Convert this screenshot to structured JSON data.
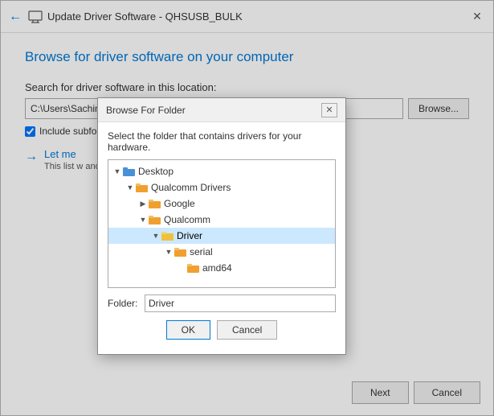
{
  "window": {
    "title": "Update Driver Software - QHSUSB_BULK",
    "close_label": "✕"
  },
  "page": {
    "title": "Browse for driver software on your computer",
    "section_label": "Search for driver software in this location:",
    "path_value": "C:\\Users\\Sachin\\Desktop\\Qualcomm Drivers\\Qualcomm\\Driver",
    "browse_button_label": "Browse...",
    "checkbox_label": "Include subfolders",
    "let_me_label": "Let me",
    "let_me_desc": "This list w                         and all driver software."
  },
  "buttons": {
    "next_label": "Next",
    "cancel_label": "Cancel"
  },
  "dialog": {
    "title": "Browse For Folder",
    "close_label": "✕",
    "description": "Select the folder that contains drivers for your hardware.",
    "folder_label": "Folder:",
    "folder_value": "Driver",
    "ok_label": "OK",
    "cancel_label": "Cancel",
    "tree": [
      {
        "level": 0,
        "toggle": "▼",
        "label": "Desktop",
        "selected": false,
        "color": "#4a90d9"
      },
      {
        "level": 1,
        "toggle": "▼",
        "label": "Qualcomm Drivers",
        "selected": false,
        "color": "#f0a030"
      },
      {
        "level": 2,
        "toggle": "",
        "label": "Google",
        "selected": false,
        "color": "#f0a030"
      },
      {
        "level": 2,
        "toggle": "▼",
        "label": "Qualcomm",
        "selected": false,
        "color": "#f0a030"
      },
      {
        "level": 3,
        "toggle": "▼",
        "label": "Driver",
        "selected": true,
        "color": "#f0a030"
      },
      {
        "level": 4,
        "toggle": "▼",
        "label": "serial",
        "selected": false,
        "color": "#f0a030"
      },
      {
        "level": 5,
        "toggle": "",
        "label": "amd64",
        "selected": false,
        "color": "#f0a030"
      }
    ]
  }
}
